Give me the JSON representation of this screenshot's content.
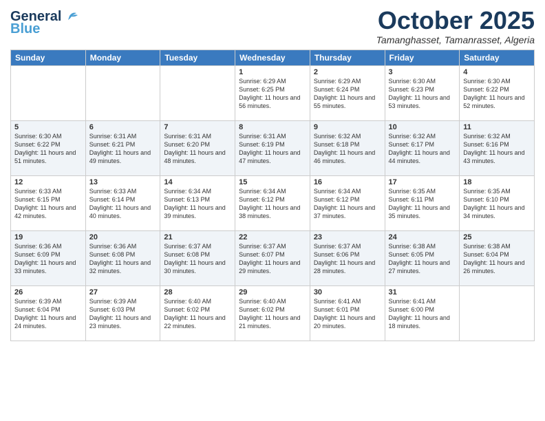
{
  "header": {
    "logo_line1": "General",
    "logo_line2": "Blue",
    "month": "October 2025",
    "location": "Tamanghasset, Tamanrasset, Algeria"
  },
  "days_of_week": [
    "Sunday",
    "Monday",
    "Tuesday",
    "Wednesday",
    "Thursday",
    "Friday",
    "Saturday"
  ],
  "weeks": [
    [
      {
        "day": "",
        "text": ""
      },
      {
        "day": "",
        "text": ""
      },
      {
        "day": "",
        "text": ""
      },
      {
        "day": "1",
        "text": "Sunrise: 6:29 AM\nSunset: 6:25 PM\nDaylight: 11 hours and 56 minutes."
      },
      {
        "day": "2",
        "text": "Sunrise: 6:29 AM\nSunset: 6:24 PM\nDaylight: 11 hours and 55 minutes."
      },
      {
        "day": "3",
        "text": "Sunrise: 6:30 AM\nSunset: 6:23 PM\nDaylight: 11 hours and 53 minutes."
      },
      {
        "day": "4",
        "text": "Sunrise: 6:30 AM\nSunset: 6:22 PM\nDaylight: 11 hours and 52 minutes."
      }
    ],
    [
      {
        "day": "5",
        "text": "Sunrise: 6:30 AM\nSunset: 6:22 PM\nDaylight: 11 hours and 51 minutes."
      },
      {
        "day": "6",
        "text": "Sunrise: 6:31 AM\nSunset: 6:21 PM\nDaylight: 11 hours and 49 minutes."
      },
      {
        "day": "7",
        "text": "Sunrise: 6:31 AM\nSunset: 6:20 PM\nDaylight: 11 hours and 48 minutes."
      },
      {
        "day": "8",
        "text": "Sunrise: 6:31 AM\nSunset: 6:19 PM\nDaylight: 11 hours and 47 minutes."
      },
      {
        "day": "9",
        "text": "Sunrise: 6:32 AM\nSunset: 6:18 PM\nDaylight: 11 hours and 46 minutes."
      },
      {
        "day": "10",
        "text": "Sunrise: 6:32 AM\nSunset: 6:17 PM\nDaylight: 11 hours and 44 minutes."
      },
      {
        "day": "11",
        "text": "Sunrise: 6:32 AM\nSunset: 6:16 PM\nDaylight: 11 hours and 43 minutes."
      }
    ],
    [
      {
        "day": "12",
        "text": "Sunrise: 6:33 AM\nSunset: 6:15 PM\nDaylight: 11 hours and 42 minutes."
      },
      {
        "day": "13",
        "text": "Sunrise: 6:33 AM\nSunset: 6:14 PM\nDaylight: 11 hours and 40 minutes."
      },
      {
        "day": "14",
        "text": "Sunrise: 6:34 AM\nSunset: 6:13 PM\nDaylight: 11 hours and 39 minutes."
      },
      {
        "day": "15",
        "text": "Sunrise: 6:34 AM\nSunset: 6:12 PM\nDaylight: 11 hours and 38 minutes."
      },
      {
        "day": "16",
        "text": "Sunrise: 6:34 AM\nSunset: 6:12 PM\nDaylight: 11 hours and 37 minutes."
      },
      {
        "day": "17",
        "text": "Sunrise: 6:35 AM\nSunset: 6:11 PM\nDaylight: 11 hours and 35 minutes."
      },
      {
        "day": "18",
        "text": "Sunrise: 6:35 AM\nSunset: 6:10 PM\nDaylight: 11 hours and 34 minutes."
      }
    ],
    [
      {
        "day": "19",
        "text": "Sunrise: 6:36 AM\nSunset: 6:09 PM\nDaylight: 11 hours and 33 minutes."
      },
      {
        "day": "20",
        "text": "Sunrise: 6:36 AM\nSunset: 6:08 PM\nDaylight: 11 hours and 32 minutes."
      },
      {
        "day": "21",
        "text": "Sunrise: 6:37 AM\nSunset: 6:08 PM\nDaylight: 11 hours and 30 minutes."
      },
      {
        "day": "22",
        "text": "Sunrise: 6:37 AM\nSunset: 6:07 PM\nDaylight: 11 hours and 29 minutes."
      },
      {
        "day": "23",
        "text": "Sunrise: 6:37 AM\nSunset: 6:06 PM\nDaylight: 11 hours and 28 minutes."
      },
      {
        "day": "24",
        "text": "Sunrise: 6:38 AM\nSunset: 6:05 PM\nDaylight: 11 hours and 27 minutes."
      },
      {
        "day": "25",
        "text": "Sunrise: 6:38 AM\nSunset: 6:04 PM\nDaylight: 11 hours and 26 minutes."
      }
    ],
    [
      {
        "day": "26",
        "text": "Sunrise: 6:39 AM\nSunset: 6:04 PM\nDaylight: 11 hours and 24 minutes."
      },
      {
        "day": "27",
        "text": "Sunrise: 6:39 AM\nSunset: 6:03 PM\nDaylight: 11 hours and 23 minutes."
      },
      {
        "day": "28",
        "text": "Sunrise: 6:40 AM\nSunset: 6:02 PM\nDaylight: 11 hours and 22 minutes."
      },
      {
        "day": "29",
        "text": "Sunrise: 6:40 AM\nSunset: 6:02 PM\nDaylight: 11 hours and 21 minutes."
      },
      {
        "day": "30",
        "text": "Sunrise: 6:41 AM\nSunset: 6:01 PM\nDaylight: 11 hours and 20 minutes."
      },
      {
        "day": "31",
        "text": "Sunrise: 6:41 AM\nSunset: 6:00 PM\nDaylight: 11 hours and 18 minutes."
      },
      {
        "day": "",
        "text": ""
      }
    ]
  ]
}
